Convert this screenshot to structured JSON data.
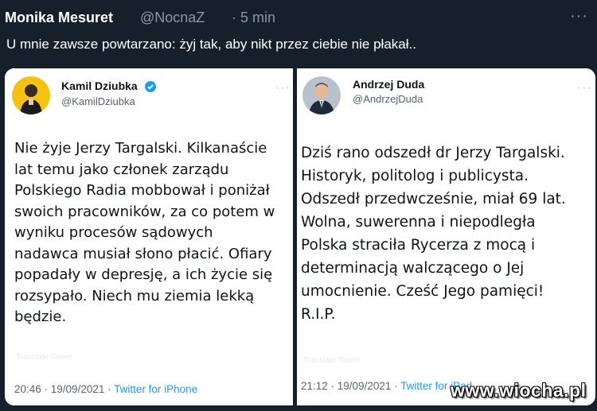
{
  "tweet": {
    "author_name": "Monika Mesuret",
    "author_handle": "@NocnaZ",
    "time": "· 5 min",
    "text": "U mnie zawsze powtarzano: żyj tak, aby nikt przez ciebie nie płakał.."
  },
  "left_card": {
    "name": "Kamil Dziubka",
    "handle": "@KamilDziubka",
    "lines": [
      "Nie żyje Jerzy Targalski. Kilkanaście",
      "lat temu jako członek zarządu",
      "Polskiego Radia mobbował i poniżał",
      "swoich pracowników, za co potem w",
      "wyniku procesów sądowych",
      "nadawca  musiał słono płacić. Ofiary",
      "popadały w depresję, a ich życie się",
      "rozsypało. Niech mu ziemia lekką",
      "będzie."
    ],
    "faded": "Translate Tweet",
    "timestamp": "20:46 · 19/09/2021 · ",
    "source": "Twitter for iPhone"
  },
  "right_card": {
    "name": "Andrzej Duda",
    "handle": "@AndrzejDuda",
    "lines": [
      "Dziś rano odszedł dr Jerzy Targalski.",
      "Historyk, politolog i publicysta.",
      "Odszedł przedwcześnie, miał 69 lat.",
      "Wolna, suwerenna i niepodległa",
      "Polska straciła Rycerza z mocą i",
      "determinacją walczącego o Jej",
      "umocnienie. Cześć Jego pamięci!",
      "R.I.P."
    ],
    "faded": "Translate Tweet",
    "timestamp": "21:12 · 19/09/2021 · ",
    "source": "Twitter for iPad"
  },
  "watermark": "www.wiocha.pl",
  "colors": {
    "background": "#15202b",
    "link": "#1d9bf0",
    "verified": "#1d9bf0",
    "muted": "#8899a6"
  }
}
